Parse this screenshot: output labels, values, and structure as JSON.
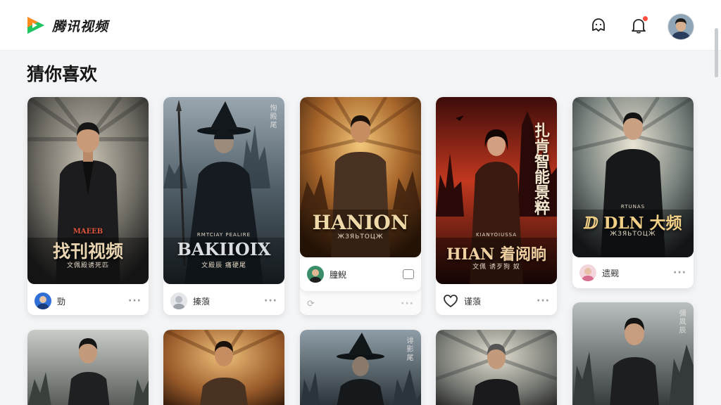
{
  "app": {
    "name": "腾讯视频"
  },
  "header": {
    "icons": [
      "chat-bubble-icon",
      "bell-icon",
      "user-avatar"
    ],
    "notification": true
  },
  "section": {
    "title": "猜你喜欢"
  },
  "colors": {
    "accent_red": "#ff4d3d",
    "background": "#f4f5f7",
    "card": "#ffffff"
  },
  "cards": [
    {
      "poster_title": "找刊视频",
      "poster_subtitle": "文佩殿诱死匹",
      "poster_tag": "MAEEB",
      "poster_vertical": "",
      "user": "勁",
      "more": "···"
    },
    {
      "poster_title": "BAKIIOIX",
      "poster_subtitle": "文殿辰 痛硬尾",
      "poster_tag": "RMTCIAY PEALIRE",
      "poster_vertical": "恂殿尾",
      "user": "搸蒗",
      "more": "···"
    },
    {
      "poster_title": "HANION",
      "poster_subtitle": "ЖЗЯЬТОЦЖ",
      "poster_tag": "",
      "poster_vertical": "",
      "user": "朣鯢",
      "more": ""
    },
    {
      "poster_title": "HIAN 着阅晌",
      "poster_subtitle": "文佩 诱歹狗 奴",
      "poster_tag": "KIANYOIUSSA",
      "poster_vertical": "扎肯智能景粹",
      "user": "",
      "more": "···"
    },
    {
      "poster_title": "ⅅ DLN 大频",
      "poster_subtitle": "ЖЗЯЬТОЦЖ",
      "poster_tag": "RTUNAS",
      "poster_vertical": "",
      "user": "遗觋",
      "more": "···"
    },
    {
      "poster_title": "",
      "poster_subtitle": "",
      "poster_tag": "",
      "poster_vertical": "",
      "user": "",
      "more": ""
    },
    {
      "poster_title": "",
      "poster_subtitle": "",
      "poster_tag": "",
      "poster_vertical": "",
      "user": "",
      "more": ""
    },
    {
      "poster_title": "",
      "poster_subtitle": "",
      "poster_tag": "",
      "poster_vertical": "诽影尾",
      "user": "",
      "more": ""
    },
    {
      "poster_title": "",
      "poster_subtitle": "",
      "poster_tag": "",
      "poster_vertical": "",
      "user": "",
      "more": ""
    },
    {
      "poster_title": "",
      "poster_subtitle": "",
      "poster_tag": "",
      "poster_vertical": "彌凮辰",
      "user": "",
      "more": ""
    }
  ],
  "floating_footers": [
    {
      "user": "",
      "more": "···"
    },
    {
      "user": "谨蒗",
      "more": "···"
    }
  ]
}
